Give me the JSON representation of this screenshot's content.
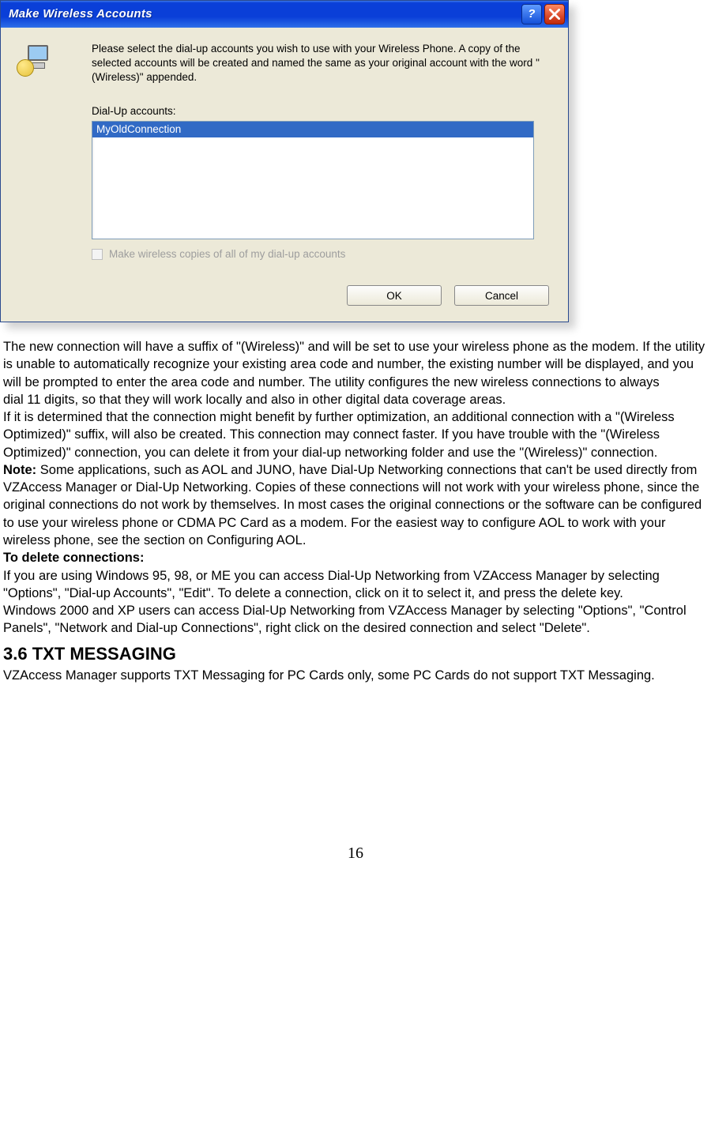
{
  "dialog": {
    "title": "Make Wireless Accounts",
    "instruction": "Please select the dial-up accounts you wish to use with your Wireless Phone.  A copy of the selected accounts will be created and named the same as your original account with the word \"(Wireless)\" appended.",
    "list_label": "Dial-Up accounts:",
    "list_item": "MyOldConnection",
    "checkbox_label": "Make wireless copies of all of my dial-up accounts",
    "ok_label": "OK",
    "cancel_label": "Cancel"
  },
  "doc": {
    "para1": "The new connection will have a suffix of \"(Wireless)\" and will be set to use your wireless phone as the modem. If the utility is unable to automatically recognize your existing area code and number, the existing number will be displayed, and you will be prompted to enter the area code and number. The utility configures the new wireless connections to always",
    "para1b": "dial 11 digits, so that they will work locally and also in other digital data coverage areas.",
    "para2": "If it is determined that the connection might benefit by further optimization, an additional connection with a \"(Wireless Optimized)\" suffix, will also be created. This connection may connect faster. If you have trouble with the \"(Wireless Optimized)\" connection, you can delete it from your dial-up networking folder and use the \"(Wireless)\" connection.",
    "note_label": "Note:",
    "note_body": " Some applications, such as AOL and JUNO, have Dial-Up Networking connections that can't be used directly from VZAccess Manager or Dial-Up Networking. Copies of these connections will not work with your wireless phone, since the original connections do not work by themselves. In most cases the original connections or the software can be configured to use your wireless phone or CDMA PC Card as a modem. For the easiest way to configure AOL to work with your wireless phone, see the section on Configuring AOL.",
    "delete_head": "To delete connections:",
    "delete_p1": "If you are using Windows 95, 98, or ME you can access Dial-Up Networking from VZAccess Manager by selecting \"Options\", \"Dial-up Accounts\", \"Edit\". To delete a connection, click on it to select it, and press the delete key.",
    "delete_p2": "Windows 2000 and XP users can access Dial-Up Networking from VZAccess Manager by selecting \"Options\", \"Control Panels\", \"Network and Dial-up Connections\", right click on the desired connection and select \"Delete\".",
    "section_head": "3.6 TXT MESSAGING",
    "section_body": "VZAccess Manager supports TXT Messaging for PC Cards only, some PC Cards do not support TXT Messaging.",
    "page_number": "16"
  }
}
